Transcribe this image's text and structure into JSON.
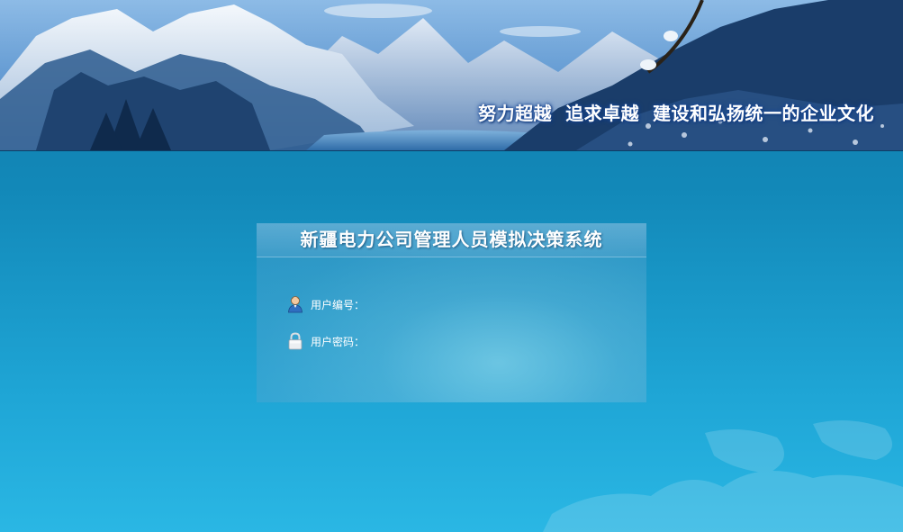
{
  "banner": {
    "slogan": "努力超越  追求卓越  建设和弘扬统一的企业文化"
  },
  "login": {
    "title": "新疆电力公司管理人员模拟决策系统",
    "user_label": "用户编号：",
    "user_value": "",
    "user_icon": "user-icon",
    "password_label": "用户密码：",
    "password_value": "",
    "password_icon": "lock-icon"
  },
  "colors": {
    "background_top": "#0f7bab",
    "background_bottom": "#2ab7e4",
    "text": "#ffffff"
  }
}
